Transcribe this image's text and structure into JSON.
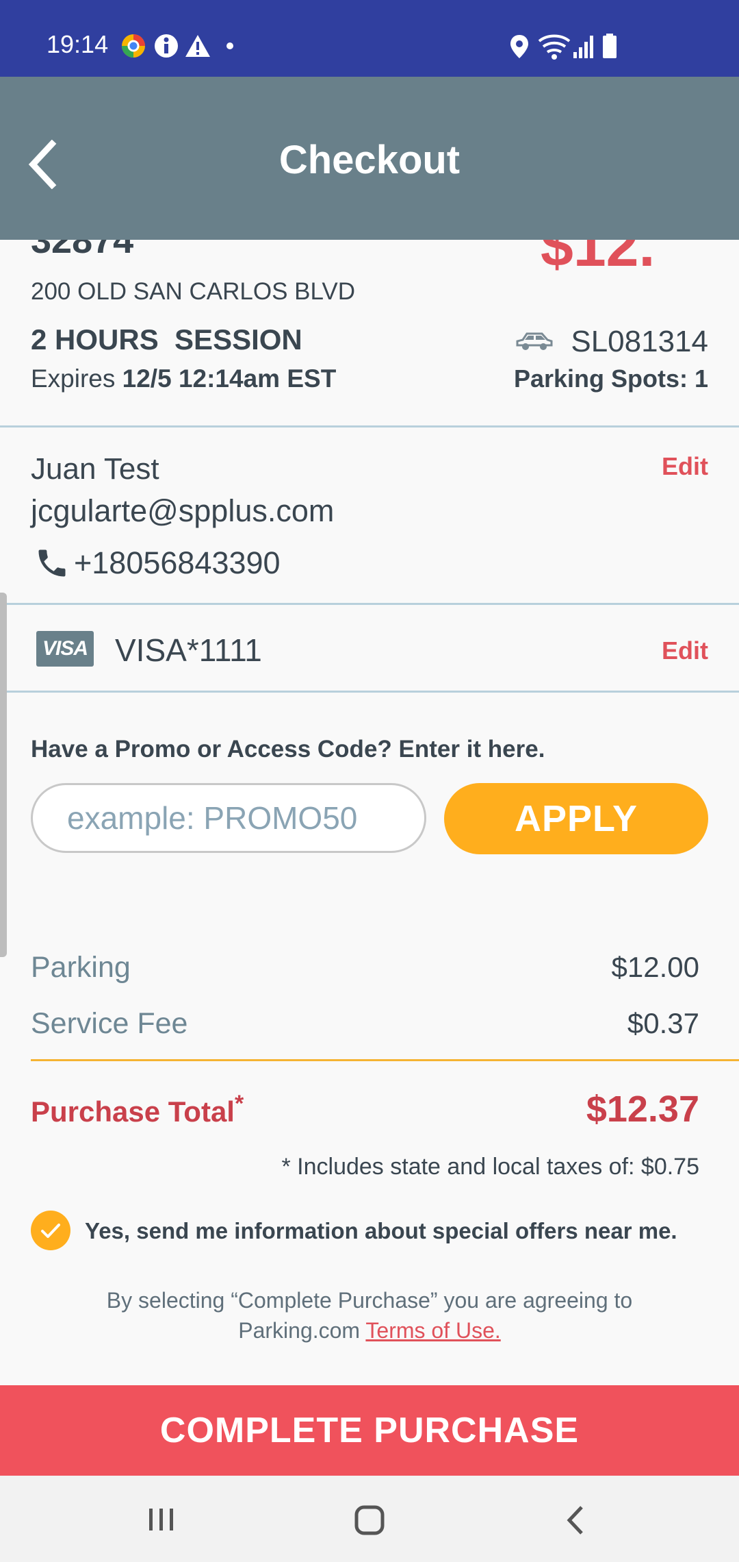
{
  "status_bar": {
    "time": "19:14"
  },
  "header": {
    "title": "Checkout"
  },
  "location": {
    "id_partial": "32874",
    "price_partial": "$12.",
    "address": "200 OLD SAN CARLOS BLVD",
    "session": "2 HOURS  SESSION",
    "expires_label": "Expires ",
    "expires_value": "12/5 12:14am EST",
    "vehicle_plate": "SL081314",
    "parking_spots": "Parking Spots: 1"
  },
  "contact": {
    "name": "Juan Test",
    "email": "jcgularte@spplus.com",
    "phone": "+18056843390",
    "edit_label": "Edit"
  },
  "payment": {
    "card_brand": "VISA",
    "card": "VISA*1111",
    "edit_label": "Edit"
  },
  "promo": {
    "prompt": "Have a Promo or Access Code? Enter it here.",
    "placeholder": "example: PROMO50",
    "apply_label": "APPLY"
  },
  "summary": {
    "lines": [
      {
        "label": "Parking",
        "amount": "$12.00"
      },
      {
        "label": "Service Fee",
        "amount": "$0.37"
      }
    ],
    "total_label": "Purchase Total",
    "total_marker": "*",
    "total_amount": "$12.37",
    "tax_note": "* Includes state and local taxes of: $0.75"
  },
  "offers": {
    "checked": true,
    "label": "Yes, send me information about special offers near me."
  },
  "terms": {
    "line1": "By selecting “Complete Purchase” you are agreeing to",
    "line2_prefix": "Parking.com ",
    "link": "Terms of Use."
  },
  "cta": {
    "label": "COMPLETE PURCHASE"
  },
  "colors": {
    "status_bar": "#303f9f",
    "header": "#69808a",
    "accent_red": "#e0515a",
    "cta_red": "#f0525c",
    "apply_yellow": "#ffae1d",
    "text": "#3a4650"
  }
}
